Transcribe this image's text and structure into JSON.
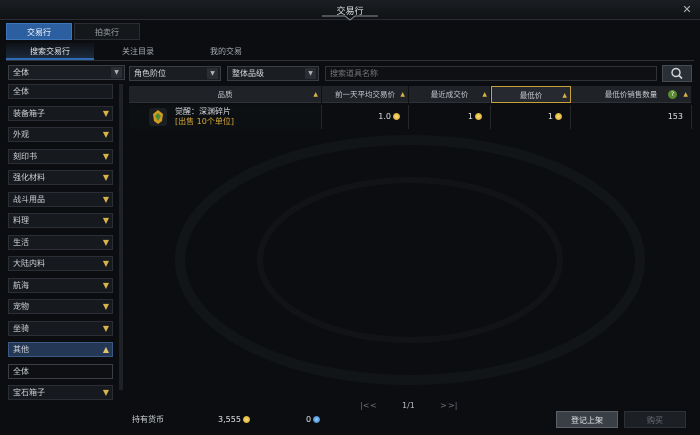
{
  "window": {
    "title": "交易行",
    "close_icon": "close-icon"
  },
  "main_tabs": [
    {
      "label": "交易行",
      "active": true
    },
    {
      "label": "拍卖行",
      "active": false
    }
  ],
  "sub_tabs": [
    {
      "label": "搜索交易行",
      "active": true
    },
    {
      "label": "关注目录",
      "active": false
    },
    {
      "label": "我的交易",
      "active": false
    }
  ],
  "sidebar": {
    "category_select": "全体",
    "categories": [
      {
        "label": "全体",
        "chevron": false,
        "state": "normal"
      },
      {
        "label": "装备箱子",
        "chevron": true,
        "state": "normal"
      },
      {
        "label": "外观",
        "chevron": true,
        "state": "normal"
      },
      {
        "label": "刻印书",
        "chevron": true,
        "state": "normal"
      },
      {
        "label": "强化材料",
        "chevron": true,
        "state": "normal"
      },
      {
        "label": "战斗用品",
        "chevron": true,
        "state": "normal"
      },
      {
        "label": "料理",
        "chevron": true,
        "state": "normal"
      },
      {
        "label": "生活",
        "chevron": true,
        "state": "normal"
      },
      {
        "label": "大陆内料",
        "chevron": true,
        "state": "normal"
      },
      {
        "label": "航海",
        "chevron": true,
        "state": "normal"
      },
      {
        "label": "宠物",
        "chevron": true,
        "state": "normal"
      },
      {
        "label": "坐骑",
        "chevron": true,
        "state": "normal"
      },
      {
        "label": "其他",
        "chevron": true,
        "state": "open"
      },
      {
        "label": "全体",
        "chevron": false,
        "state": "sub"
      },
      {
        "label": "宝石箱子",
        "chevron": true,
        "state": "normal"
      }
    ]
  },
  "filters": {
    "sort_select": "角色阶位",
    "grade_select": "整体品级",
    "search_placeholder": "搜索道具名称"
  },
  "table": {
    "headers": [
      "品质",
      "前一天平均交易价",
      "最近成交价",
      "最低价",
      "最低价销售数量"
    ],
    "help_symbol": "?",
    "rows": [
      {
        "name": "觉醒：深渊碎片",
        "sub": "[出售 10个单位]",
        "avg_price": "1.0",
        "recent_price": "1",
        "lowest_price": "1",
        "quantity": "153"
      }
    ]
  },
  "pager": {
    "first": "|<",
    "prev": "<",
    "page": "1/1",
    "next": ">",
    "last": ">|"
  },
  "footer": {
    "currency_label": "持有货币",
    "gold": "3,555",
    "crystal": "0",
    "register_button": "登记上架",
    "buy_button": "购买"
  }
}
